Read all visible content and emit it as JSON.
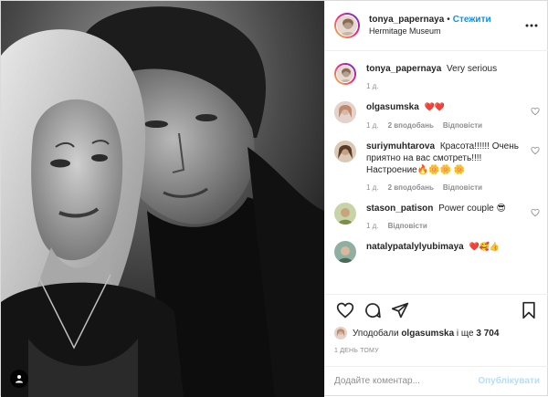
{
  "post": {
    "author": "tonya_papernaya",
    "follow_label": "Стежити",
    "separator": "•",
    "location": "Hermitage Museum",
    "more_icon": "more-horizontal-icon",
    "tag_icon": "user-tag-icon"
  },
  "caption": {
    "username": "tonya_papernaya",
    "text": "Very serious",
    "age": "1 д."
  },
  "comments": [
    {
      "username": "olgasumska",
      "text": "❤️❤️",
      "age": "1 д.",
      "likes": "2 вподобань",
      "reply": "Відповісти"
    },
    {
      "username": "suriymuhtarova",
      "text": "Красота!!!!!! Очень приятно на вас смотреть!!!! Настроение🔥🌼🌼 🌼",
      "age": "1 д.",
      "likes": "2 вподобань",
      "reply": "Відповісти"
    },
    {
      "username": "stason_patison",
      "text": "Power couple 😎",
      "age": "1 д.",
      "reply": "Відповісти"
    },
    {
      "username": "natalypatalylyubimaya",
      "text": "❤️🥰👍"
    }
  ],
  "actions": {
    "like_icon": "heart-icon",
    "comment_icon": "comment-icon",
    "share_icon": "share-icon",
    "save_icon": "bookmark-icon"
  },
  "likes": {
    "prefix": "Уподобали",
    "user": "olgasumska",
    "and": "і ще",
    "count": "3 704"
  },
  "date": "1 ДЕНЬ ТОМУ",
  "add_comment": {
    "placeholder": "Додайте коментар...",
    "publish_label": "Опублікувати"
  },
  "colors": {
    "accent": "#0095f6",
    "accent_disabled": "#b2dffc",
    "secondary_text": "#8e8e8e",
    "border": "#dbdbdb"
  }
}
